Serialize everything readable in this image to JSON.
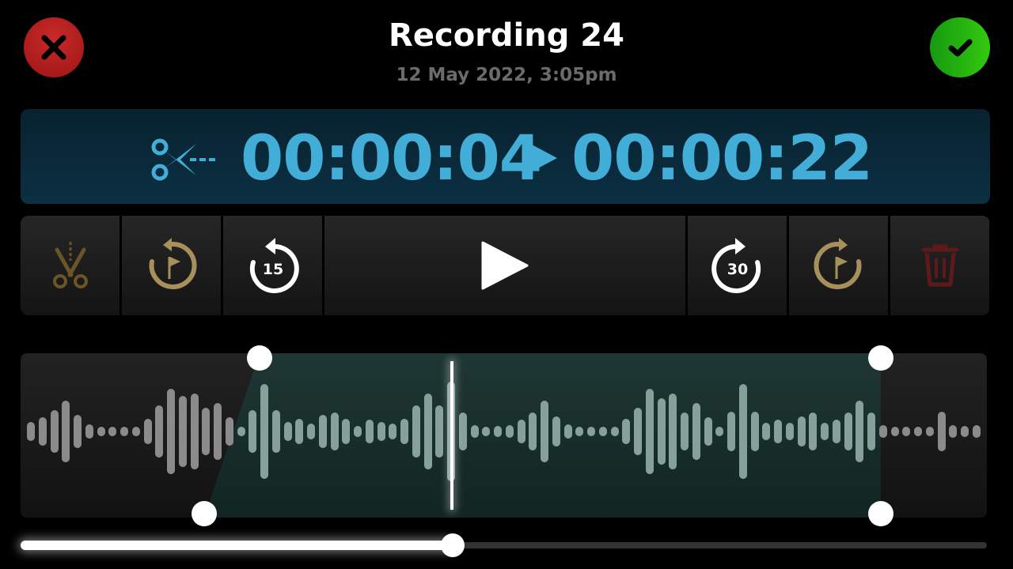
{
  "header": {
    "title": "Recording 24",
    "subtitle": "12 May 2022, 3:05pm",
    "cancel_icon": "close-icon",
    "confirm_icon": "checkmark-icon",
    "cancel_color": "#b31f1f",
    "confirm_color": "#25b010"
  },
  "trim_range": {
    "icon": "scissors-icon",
    "start_time": "00:00:04",
    "separator_icon": "play-arrow-icon",
    "end_time": "00:00:22",
    "accent_color": "#42aed7"
  },
  "toolbar": {
    "buttons": [
      {
        "name": "trim",
        "icon": "scissors-icon",
        "enabled": false
      },
      {
        "name": "jump-to-start-marker",
        "icon": "rewind-to-flag-icon"
      },
      {
        "name": "rewind-15",
        "icon": "rewind-icon",
        "label": "15"
      },
      {
        "name": "play",
        "icon": "play-icon"
      },
      {
        "name": "forward-30",
        "icon": "forward-icon",
        "label": "30"
      },
      {
        "name": "jump-to-end-marker",
        "icon": "forward-to-flag-icon"
      },
      {
        "name": "delete",
        "icon": "trash-icon",
        "enabled": false
      }
    ]
  },
  "waveform": {
    "amplitudes": [
      0.2,
      0.3,
      0.45,
      0.65,
      0.35,
      0.15,
      0.1,
      0.1,
      0.1,
      0.1,
      0.27,
      0.55,
      0.9,
      0.75,
      0.8,
      0.5,
      0.6,
      0.3,
      0.1,
      0.45,
      1.0,
      0.45,
      0.2,
      0.27,
      0.17,
      0.35,
      0.4,
      0.27,
      0.12,
      0.25,
      0.2,
      0.17,
      0.27,
      0.55,
      0.8,
      0.55,
      1.05,
      0.4,
      0.14,
      0.1,
      0.12,
      0.14,
      0.25,
      0.4,
      0.65,
      0.32,
      0.15,
      0.1,
      0.1,
      0.1,
      0.1,
      0.27,
      0.5,
      0.9,
      0.7,
      0.8,
      0.4,
      0.6,
      0.3,
      0.1,
      0.42,
      1.0,
      0.42,
      0.18,
      0.25,
      0.18,
      0.32,
      0.4,
      0.18,
      0.25,
      0.4,
      0.65,
      0.4,
      0.14,
      0.1,
      0.1,
      0.1,
      0.1,
      0.42,
      0.14,
      0.12,
      0.14
    ],
    "selection_start_fraction": 0.19,
    "selection_end_fraction": 0.89,
    "playhead_fraction": 0.446
  },
  "playback": {
    "progress_fraction": 0.447
  }
}
